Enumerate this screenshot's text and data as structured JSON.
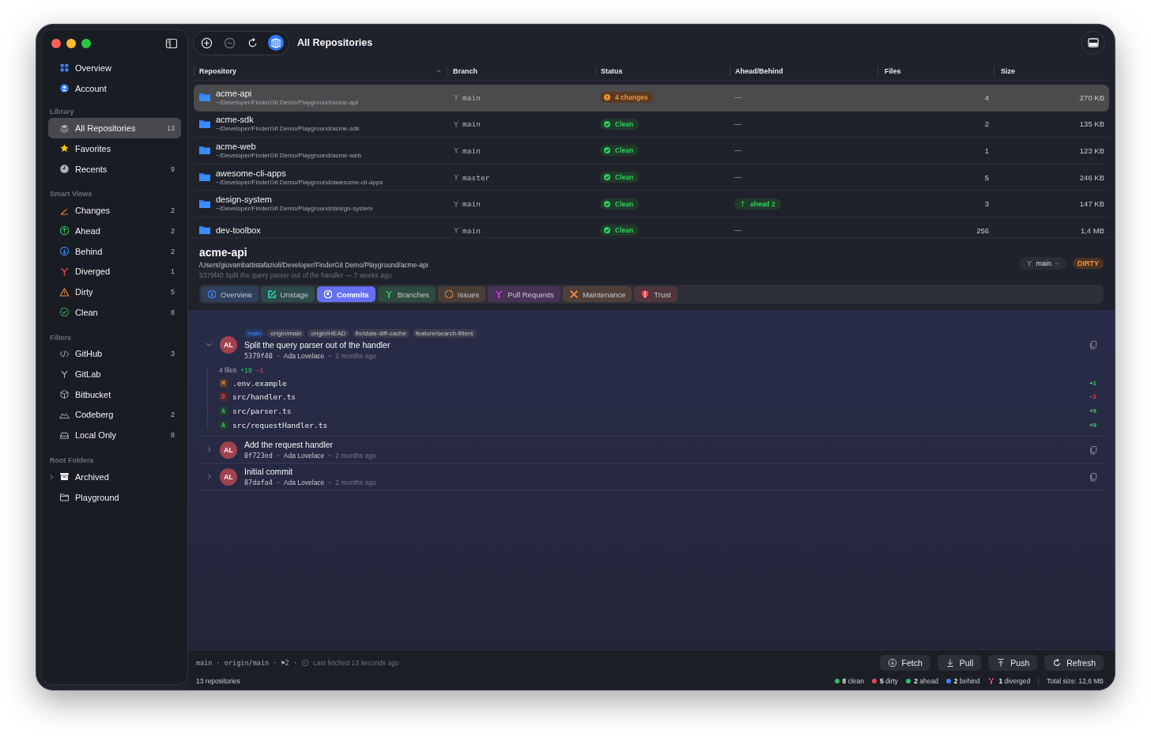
{
  "toolbar": {
    "title": "All Repositories"
  },
  "sidebar": {
    "top_items": [
      {
        "label": "Overview",
        "kind": "overview",
        "selected": false
      },
      {
        "label": "Account",
        "kind": "account",
        "selected": false
      }
    ],
    "sections": [
      {
        "title": "Library",
        "items": [
          {
            "label": "All Repositories",
            "kind": "all",
            "count": "13",
            "selected": true
          },
          {
            "label": "Favorites",
            "kind": "favorites",
            "selected": false
          },
          {
            "label": "Recents",
            "kind": "recents",
            "count": "9",
            "selected": false
          }
        ]
      },
      {
        "title": "Smart Views",
        "items": [
          {
            "label": "Changes",
            "kind": "changes",
            "count": "2",
            "selected": false
          },
          {
            "label": "Ahead",
            "kind": "ahead",
            "count": "2",
            "selected": false
          },
          {
            "label": "Behind",
            "kind": "behind",
            "count": "2",
            "selected": false
          },
          {
            "label": "Diverged",
            "kind": "diverged",
            "count": "1",
            "selected": false
          },
          {
            "label": "Dirty",
            "kind": "dirty",
            "count": "5",
            "selected": false
          },
          {
            "label": "Clean",
            "kind": "clean",
            "count": "8",
            "selected": false
          }
        ]
      },
      {
        "title": "Filters",
        "items": [
          {
            "label": "GitHub",
            "kind": "github",
            "count": "3",
            "selected": false
          },
          {
            "label": "GitLab",
            "kind": "gitlab",
            "selected": false
          },
          {
            "label": "Bitbucket",
            "kind": "bitbucket",
            "selected": false
          },
          {
            "label": "Codeberg",
            "kind": "codeberg",
            "count": "2",
            "selected": false
          },
          {
            "label": "Local Only",
            "kind": "local",
            "count": "8",
            "selected": false
          }
        ]
      },
      {
        "title": "Root Folders",
        "items": [
          {
            "label": "Archived",
            "kind": "archived",
            "expanded": false,
            "selected": false
          },
          {
            "label": "Playground",
            "kind": "playground",
            "selected": false
          }
        ]
      }
    ]
  },
  "table": {
    "columns": [
      {
        "label": "Repository",
        "sorted": true
      },
      {
        "label": "Branch",
        "sorted": false
      },
      {
        "label": "Status",
        "sorted": false
      },
      {
        "label": "Ahead/Behind",
        "sorted": false
      },
      {
        "label": "Files",
        "sorted": false
      },
      {
        "label": "Size",
        "sorted": false
      }
    ],
    "rows": [
      {
        "name": "acme-api",
        "path": "~/Developer/FinderGit Demo/Playground/acme-api",
        "branch": "main",
        "status": {
          "kind": "changes",
          "text": "4 changes"
        },
        "ahead_behind": {
          "kind": "none",
          "text": "—"
        },
        "files": "4",
        "size": "270 KB",
        "selected": true
      },
      {
        "name": "acme-sdk",
        "path": "~/Developer/FinderGit Demo/Playground/acme-sdk",
        "branch": "main",
        "status": {
          "kind": "clean",
          "text": "Clean"
        },
        "ahead_behind": {
          "kind": "none",
          "text": "—"
        },
        "files": "2",
        "size": "135 KB",
        "selected": false
      },
      {
        "name": "acme-web",
        "path": "~/Developer/FinderGit Demo/Playground/acme-web",
        "branch": "main",
        "status": {
          "kind": "clean",
          "text": "Clean"
        },
        "ahead_behind": {
          "kind": "none",
          "text": "—"
        },
        "files": "1",
        "size": "123 KB",
        "selected": false
      },
      {
        "name": "awesome-cli-apps",
        "path": "~/Developer/FinderGit Demo/Playground/awesome-cli-apps",
        "branch": "master",
        "status": {
          "kind": "clean",
          "text": "Clean"
        },
        "ahead_behind": {
          "kind": "none",
          "text": "—"
        },
        "files": "5",
        "size": "246 KB",
        "selected": false
      },
      {
        "name": "design-system",
        "path": "~/Developer/FinderGit Demo/Playground/design-system",
        "branch": "main",
        "status": {
          "kind": "clean",
          "text": "Clean"
        },
        "ahead_behind": {
          "kind": "ahead",
          "text": "ahead 2"
        },
        "files": "3",
        "size": "147 KB",
        "selected": false
      },
      {
        "name": "dev-toolbox",
        "branch": "main",
        "status": {
          "kind": "clean",
          "text": "Clean"
        },
        "ahead_behind": {
          "kind": "none",
          "text": "—"
        },
        "files": "256",
        "size": "1,4 MB",
        "selected": false
      }
    ]
  },
  "detail": {
    "name": "acme-api",
    "path": "/Users/giovambattistafazioli/Developer/FinderGit Demo/Playground/acme-api",
    "last_commit": "5379f40 Split the query parser out of the handler — 7 weeks ago",
    "branch": "main",
    "state": "DIRTY",
    "tabs": [
      {
        "label": "Overview",
        "kind": "overview",
        "color": "#3b82f6",
        "selected": false
      },
      {
        "label": "Unstage",
        "kind": "unstage",
        "color": "#2fb8a0",
        "selected": false
      },
      {
        "label": "Commits",
        "kind": "commits",
        "color": "#6470f0",
        "selected": true
      },
      {
        "label": "Branches",
        "kind": "branches",
        "color": "#30c05a",
        "selected": false
      },
      {
        "label": "Issues",
        "kind": "issues",
        "color": "#d07a2c",
        "selected": false
      },
      {
        "label": "Pull Requests",
        "kind": "pulls",
        "color": "#c042d8",
        "selected": false
      },
      {
        "label": "Maintenance",
        "kind": "maintenance",
        "color": "#e0803a",
        "selected": false
      },
      {
        "label": "Trust",
        "kind": "trust",
        "color": "#e5484d",
        "selected": false
      }
    ]
  },
  "commits": [
    {
      "refs": [
        {
          "label": "main",
          "kind": "head"
        },
        {
          "label": "origin/main",
          "kind": "other"
        },
        {
          "label": "origin/HEAD",
          "kind": "other"
        },
        {
          "label": "fix/stale-diff-cache",
          "kind": "other"
        },
        {
          "label": "feature/search-filters",
          "kind": "other"
        }
      ],
      "message": "Split the query parser out of the handler",
      "initials": "AL",
      "hash": "5379f40",
      "author": "Ada Lovelace",
      "time": "2 months ago",
      "expanded": true,
      "summary": {
        "files": "4 files",
        "added": "+19",
        "removed": "−1"
      },
      "files": [
        {
          "letter": "M",
          "kind": "modified",
          "path": ".env.example",
          "delta": "+1"
        },
        {
          "letter": "D",
          "kind": "deleted",
          "path": "src/handler.ts",
          "delta": "−1"
        },
        {
          "letter": "A",
          "kind": "added",
          "path": "src/parser.ts",
          "delta": "+9"
        },
        {
          "letter": "A",
          "kind": "added",
          "path": "src/requestHandler.ts",
          "delta": "+9"
        }
      ]
    },
    {
      "message": "Add the request handler",
      "initials": "AL",
      "hash": "0f723ed",
      "author": "Ada Lovelace",
      "time": "2 months ago",
      "expanded": false
    },
    {
      "message": "Initial commit",
      "initials": "AL",
      "hash": "87dafa4",
      "author": "Ada Lovelace",
      "time": "2 months ago",
      "expanded": false
    }
  ],
  "footer": {
    "branch_info": "main · origin/main · ⚑2 ·",
    "fetched": "Last fetched 13 seconds ago",
    "buttons": [
      {
        "label": "Fetch",
        "kind": "fetch"
      },
      {
        "label": "Pull",
        "kind": "pull"
      },
      {
        "label": "Push",
        "kind": "push"
      },
      {
        "label": "Refresh",
        "kind": "refresh"
      }
    ]
  },
  "status_bar": {
    "count": "13 repositories",
    "stats": [
      {
        "text": "**8** clean",
        "kind": "dot",
        "color": "#30c05a"
      },
      {
        "text": "**5** dirty",
        "kind": "dot",
        "color": "#e5484d"
      },
      {
        "text": "**2** ahead",
        "kind": "dot",
        "color": "#30c05a"
      },
      {
        "text": "**2** behind",
        "kind": "dot",
        "color": "#3b82f6"
      },
      {
        "text": "**1** diverged",
        "kind": "fork",
        "color": "#e5484d"
      }
    ],
    "total": "Total size: 12,6 MB"
  }
}
